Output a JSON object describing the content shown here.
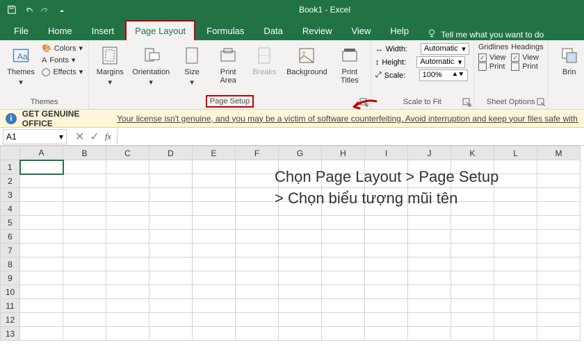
{
  "title": "Book1 - Excel",
  "tabs": [
    "File",
    "Home",
    "Insert",
    "Page Layout",
    "Formulas",
    "Data",
    "Review",
    "View",
    "Help"
  ],
  "active_tab": "Page Layout",
  "tellme": "Tell me what you want to do",
  "groups": {
    "themes": {
      "label": "Themes",
      "themes_btn": "Themes",
      "colors": "Colors",
      "fonts": "Fonts",
      "effects": "Effects"
    },
    "page_setup": {
      "label": "Page Setup",
      "margins": "Margins",
      "orientation": "Orientation",
      "size": "Size",
      "print_area": "Print\nArea",
      "breaks": "Breaks",
      "background": "Background",
      "print_titles": "Print\nTitles"
    },
    "scale": {
      "label": "Scale to Fit",
      "width": "Width:",
      "width_val": "Automatic",
      "height": "Height:",
      "height_val": "Automatic",
      "scale": "Scale:",
      "scale_val": "100%"
    },
    "sheet": {
      "label": "Sheet Options",
      "gridlines": "Gridlines",
      "headings": "Headings",
      "view": "View",
      "print": "Print"
    },
    "bring": "Brin"
  },
  "notice": {
    "title": "GET GENUINE OFFICE",
    "msg": "Your license isn't genuine, and you may be a victim of software counterfeiting. Avoid interruption and keep your files safe with g"
  },
  "namebox": "A1",
  "fx": "fx",
  "columns": [
    "A",
    "B",
    "C",
    "D",
    "E",
    "F",
    "G",
    "H",
    "I",
    "J",
    "K",
    "L",
    "M"
  ],
  "rows": [
    "1",
    "2",
    "3",
    "4",
    "5",
    "6",
    "7",
    "8",
    "9",
    "10",
    "11",
    "12",
    "13"
  ],
  "annotation": "Chọn Page Layout > Page Setup\n> Chọn biểu tượng mũi tên"
}
